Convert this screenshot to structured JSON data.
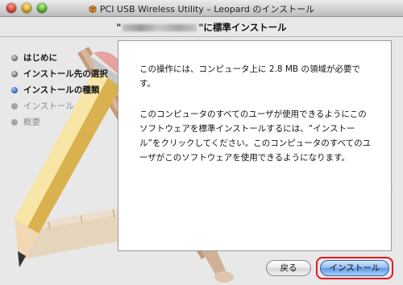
{
  "window": {
    "title": "PCI USB Wireless Utility – Leopard のインストール",
    "header_title_suffix": "\"に標準インストール",
    "header_title_prefix": "\""
  },
  "steps": [
    {
      "label": "はじめに",
      "state": "done"
    },
    {
      "label": "インストール先の選択",
      "state": "done"
    },
    {
      "label": "インストールの種類",
      "state": "current"
    },
    {
      "label": "インストール",
      "state": "future"
    },
    {
      "label": "概要",
      "state": "future"
    }
  ],
  "content": {
    "para1": "この操作には、コンピュータ上に 2.8 MB の領域が必要です。",
    "para2": "このコンピュータのすべてのユーザが使用できるようにこのソフトウェアを標準インストールするには、“インストール”をクリックしてください。このコンピュータのすべてのユーザがこのソフトウェアを使用できるようになります。"
  },
  "buttons": {
    "back_label": "戻る",
    "install_label": "インストール"
  },
  "colors": {
    "highlight": "#e4191f",
    "current_step": "#1f55b5"
  }
}
